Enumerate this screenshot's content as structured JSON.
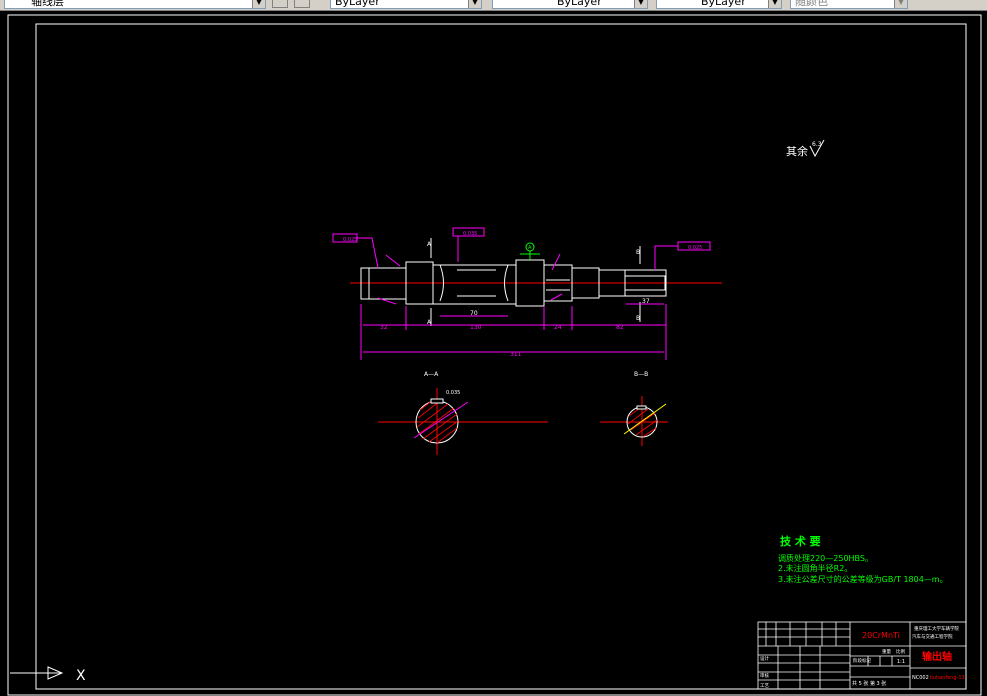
{
  "toolbar": {
    "layer_control": "轴线层",
    "color_control": "ByLayer",
    "linetype_control": "ByLayer",
    "lineweight_control": "ByLayer",
    "plotstyle_control": "随颜色"
  },
  "drawing": {
    "roughness_note": "其余",
    "roughness_value": "6.3",
    "section_a_label": "A—A",
    "section_b_label": "B—B",
    "dims": {
      "overall_length": "311",
      "seg_left": "32",
      "seg_mid": "130",
      "seg_key": "70",
      "seg_right_shoulder": "24",
      "seg_right": "82",
      "keyway_right": "37"
    },
    "tolerances": {
      "tol1": "0.025",
      "tol2": "0.035",
      "tol3": "0.025",
      "tol4": "0.035",
      "datum": "A"
    },
    "tech_requirements": {
      "title": "技 术 要",
      "line1": "调质处理220—250HBS。",
      "line2": "2.未注圆角半径R2。",
      "line3": "3.未注公差尺寸的公差等级为GB/T 1804—m。"
    },
    "title_block": {
      "material": "20CrMnTi",
      "part_name": "输出轴",
      "school": "重庆理工大学车辆学院",
      "dept": "汽车与交通工程学院",
      "drawing_no": "NC002",
      "designer_code": "liuhanfeng-13",
      "sheet_text": "共 5 张  第 3 张",
      "scale": "1:1",
      "labels": {
        "design": "设计",
        "check": "审核",
        "process": "工艺",
        "stage": "阶段标记",
        "weight": "重量",
        "ratio": "比例"
      }
    }
  },
  "ucs": {
    "x_label": "X"
  }
}
